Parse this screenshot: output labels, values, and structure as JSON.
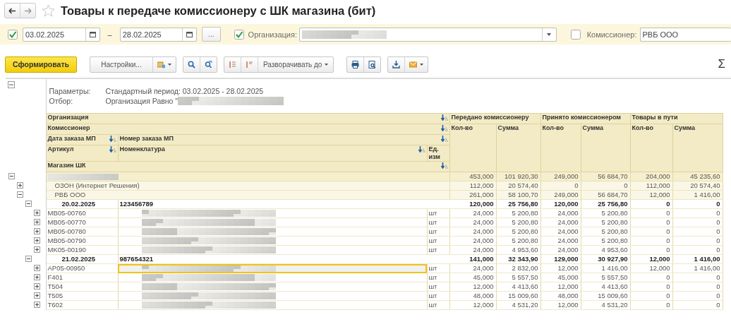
{
  "window": {
    "title": "Товары к передаче комиссионеру с ШК магазина (бит)",
    "favorite": false
  },
  "filters": {
    "period": {
      "checked": true,
      "from": "03.02.2025",
      "dash": "–",
      "to": "28.02.2025",
      "more_button": "..."
    },
    "organization": {
      "checked": true,
      "label": "Организация:",
      "redacted": true
    },
    "commissioner": {
      "checked": false,
      "label": "Комиссионер:",
      "value": "РВБ ООО"
    }
  },
  "toolbar": {
    "generate_button": "Сформировать",
    "settings_button": "Настройки...",
    "expand_button": "Разворачивать до",
    "sum_symbol": "Σ"
  },
  "report": {
    "expanded": true,
    "parameters": [
      {
        "label": "Параметры:",
        "value": "Стандартный период: 03.02.2025 - 28.02.2025"
      },
      {
        "label": "Отбор:",
        "value": "Организация Равно \"",
        "redacted": true
      }
    ],
    "group_headers": [
      "Организация",
      "Комиссионер"
    ],
    "order_headers": [
      "Дата заказа МП",
      "Номер заказа МП"
    ],
    "item_headers": [
      "Артикул",
      "Номенклатура",
      "Ед. изм"
    ],
    "shop_header": "Магазин ШК",
    "measure_groups": [
      {
        "title": "Передано комиссионеру",
        "columns": [
          "Кол-во",
          "Сумма"
        ]
      },
      {
        "title": "Принято комиссионером",
        "columns": [
          "Кол-во",
          "Сумма"
        ]
      },
      {
        "title": "Товары в пути",
        "columns": [
          "Кол-во",
          "Сумма"
        ]
      }
    ],
    "rows": [
      {
        "kind": "organization",
        "redacted": true,
        "expanded": true,
        "values": [
          "453,000",
          "101 920,30",
          "249,000",
          "56 684,70",
          "204,000",
          "45 235,60"
        ],
        "children": [
          {
            "kind": "commissioner",
            "name": "ОЗОН (Интернет Решения)",
            "expanded": false,
            "values": [
              "112,000",
              "20 574,40",
              "0",
              "0",
              "112,000",
              "20 574,40"
            ]
          },
          {
            "kind": "commissioner",
            "name": "РВБ ООО",
            "expanded": true,
            "values": [
              "261,000",
              "58 100,70",
              "249,000",
              "56 684,70",
              "12,000",
              "1 416,00"
            ],
            "children": [
              {
                "kind": "order",
                "date": "20.02.2025",
                "number": "123456789",
                "expanded": true,
                "values": [
                  "120,000",
                  "25 756,80",
                  "120,000",
                  "25 756,80",
                  "0",
                  "0"
                ],
                "children": [
                  {
                    "kind": "item",
                    "article": "MB05-00760",
                    "unit": "шт",
                    "redacted": true,
                    "selected": false,
                    "expanded": false,
                    "values": [
                      "24,000",
                      "5 200,80",
                      "24,000",
                      "5 200,80",
                      "0",
                      "0"
                    ]
                  },
                  {
                    "kind": "item",
                    "article": "MB05-00770",
                    "unit": "шт",
                    "redacted": true,
                    "selected": false,
                    "expanded": false,
                    "values": [
                      "24,000",
                      "5 200,80",
                      "24,000",
                      "5 200,80",
                      "0",
                      "0"
                    ]
                  },
                  {
                    "kind": "item",
                    "article": "MB05-00780",
                    "unit": "шт",
                    "redacted": true,
                    "selected": false,
                    "expanded": false,
                    "values": [
                      "24,000",
                      "5 200,80",
                      "24,000",
                      "5 200,80",
                      "0",
                      "0"
                    ]
                  },
                  {
                    "kind": "item",
                    "article": "MB05-00790",
                    "unit": "шт",
                    "redacted": true,
                    "selected": false,
                    "expanded": false,
                    "values": [
                      "24,000",
                      "5 200,80",
                      "24,000",
                      "5 200,80",
                      "0",
                      "0"
                    ]
                  },
                  {
                    "kind": "item",
                    "article": "MK05-00190",
                    "unit": "шт",
                    "redacted": true,
                    "selected": false,
                    "expanded": false,
                    "values": [
                      "24,000",
                      "4 953,60",
                      "24,000",
                      "4 953,60",
                      "0",
                      "0"
                    ]
                  }
                ]
              },
              {
                "kind": "order",
                "date": "21.02.2025",
                "number": "987654321",
                "expanded": true,
                "values": [
                  "141,000",
                  "32 343,90",
                  "129,000",
                  "30 927,90",
                  "12,000",
                  "1 416,00"
                ],
                "children": [
                  {
                    "kind": "item",
                    "article": "AP05-00950",
                    "unit": "шт",
                    "redacted": true,
                    "selected": true,
                    "expanded": false,
                    "values": [
                      "24,000",
                      "2 832,00",
                      "12,000",
                      "1 416,00",
                      "12,000",
                      "1 416,00"
                    ]
                  },
                  {
                    "kind": "item",
                    "article": "F401",
                    "unit": "шт",
                    "redacted": true,
                    "selected": false,
                    "expanded": false,
                    "values": [
                      "45,000",
                      "5 557,50",
                      "45,000",
                      "5 557,50",
                      "0",
                      "0"
                    ]
                  },
                  {
                    "kind": "item",
                    "article": "T504",
                    "unit": "шт",
                    "redacted": true,
                    "selected": false,
                    "expanded": false,
                    "values": [
                      "12,000",
                      "4 413,60",
                      "12,000",
                      "4 413,60",
                      "0",
                      "0"
                    ]
                  },
                  {
                    "kind": "item",
                    "article": "T505",
                    "unit": "шт",
                    "redacted": true,
                    "selected": false,
                    "expanded": false,
                    "values": [
                      "48,000",
                      "15 009,60",
                      "48,000",
                      "15 009,60",
                      "0",
                      "0"
                    ]
                  },
                  {
                    "kind": "item",
                    "article": "T602",
                    "unit": "шт",
                    "redacted": true,
                    "selected": false,
                    "expanded": false,
                    "values": [
                      "12,000",
                      "4 531,20",
                      "12,000",
                      "4 531,20",
                      "0",
                      "0"
                    ]
                  }
                ]
              }
            ]
          }
        ]
      }
    ]
  }
}
